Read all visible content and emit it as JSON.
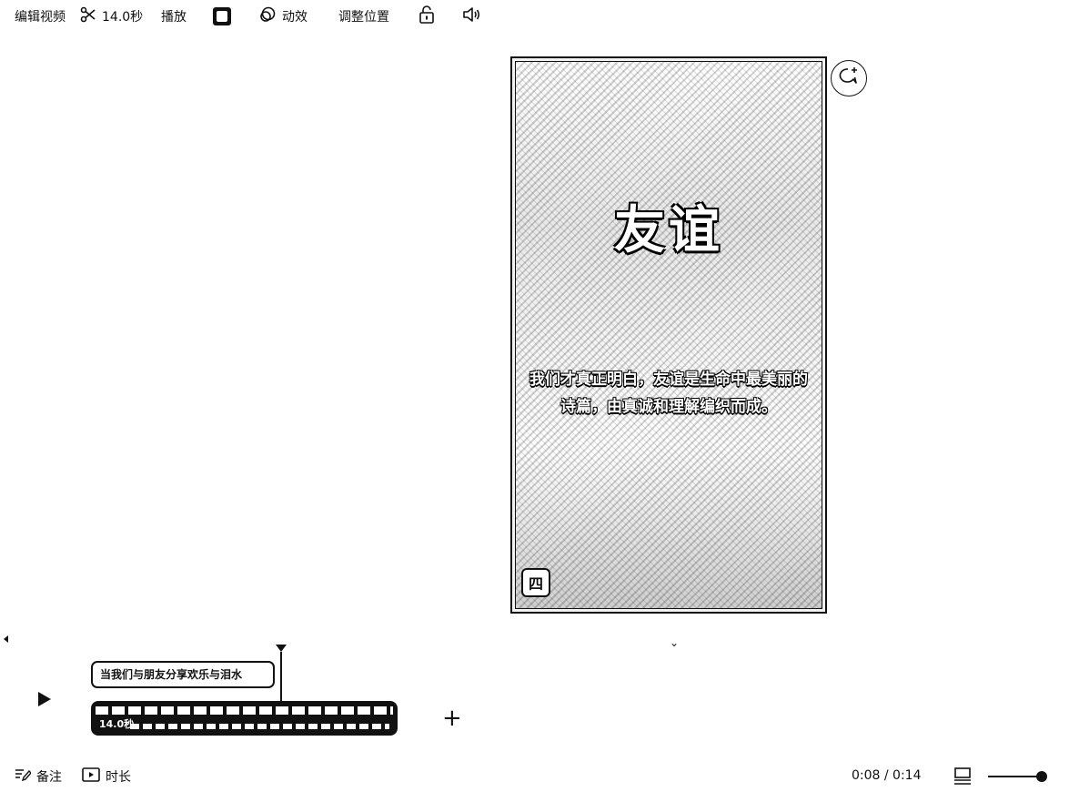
{
  "toolbar": {
    "edit_video_label": "编辑视频",
    "duration_label": "14.0秒",
    "playback_label": "播放",
    "animation_label": "动效",
    "adjust_position_label": "调整位置"
  },
  "preview": {
    "title": "友谊",
    "caption": "我们才真正明白，友谊是生命中最美丽的诗篇，由真诚和理解编织而成。",
    "badge": "四"
  },
  "timeline": {
    "caption_clip_text": "当我们与朋友分享欢乐与泪水",
    "video_clip_duration": "14.0秒"
  },
  "footer": {
    "notes_label": "备注",
    "duration_label": "时长",
    "time_readout": "0:08 / 0:14",
    "zoom_level": 1.0
  }
}
